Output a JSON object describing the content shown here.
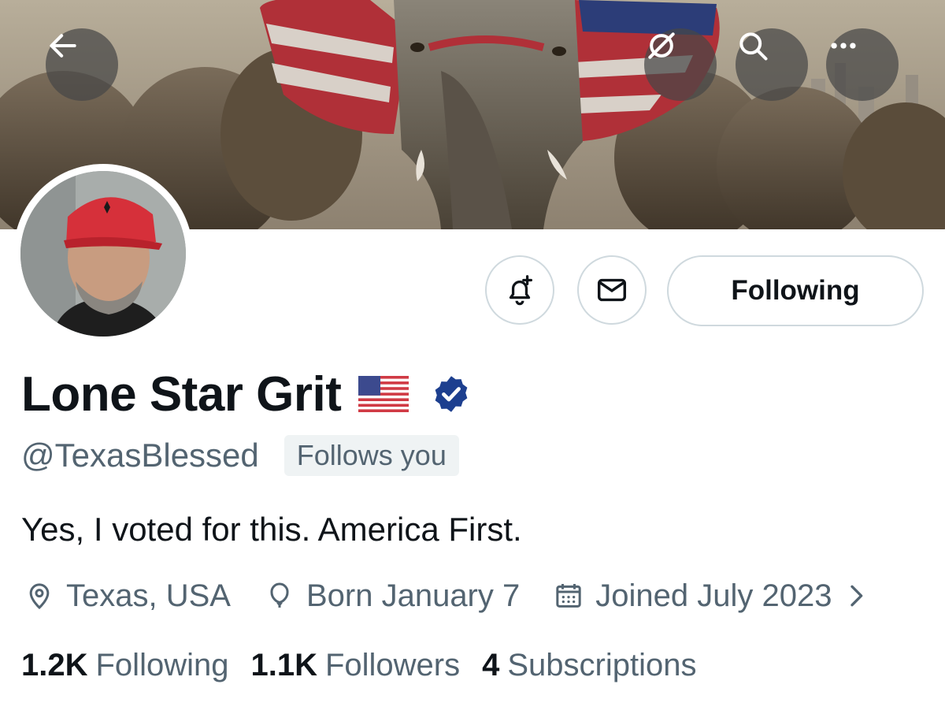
{
  "header": {
    "back_icon": "arrow-left-icon",
    "grok_icon": "grok-icon",
    "search_icon": "search-icon",
    "more_icon": "more-horizontal-icon"
  },
  "actions": {
    "notify_icon": "bell-plus-icon",
    "message_icon": "envelope-icon",
    "following_label": "Following"
  },
  "profile": {
    "display_name": "Lone Star Grit",
    "flag_emoji": "🇺🇸",
    "verified": true,
    "handle": "@TexasBlessed",
    "follows_you": "Follows you",
    "bio": "Yes, I voted for this. America First.",
    "location": "Texas, USA",
    "birthday": "Born January 7",
    "joined": "Joined July 2023"
  },
  "stats": {
    "following_count": "1.2K",
    "following_label": "Following",
    "followers_count": "1.1K",
    "followers_label": "Followers",
    "subscriptions_count": "4",
    "subscriptions_label": "Subscriptions"
  },
  "colors": {
    "text_primary": "#0f1419",
    "text_secondary": "#536471",
    "verified_blue": "#1d3f8f",
    "border": "#cfd9de",
    "badge_bg": "#eff3f4"
  }
}
